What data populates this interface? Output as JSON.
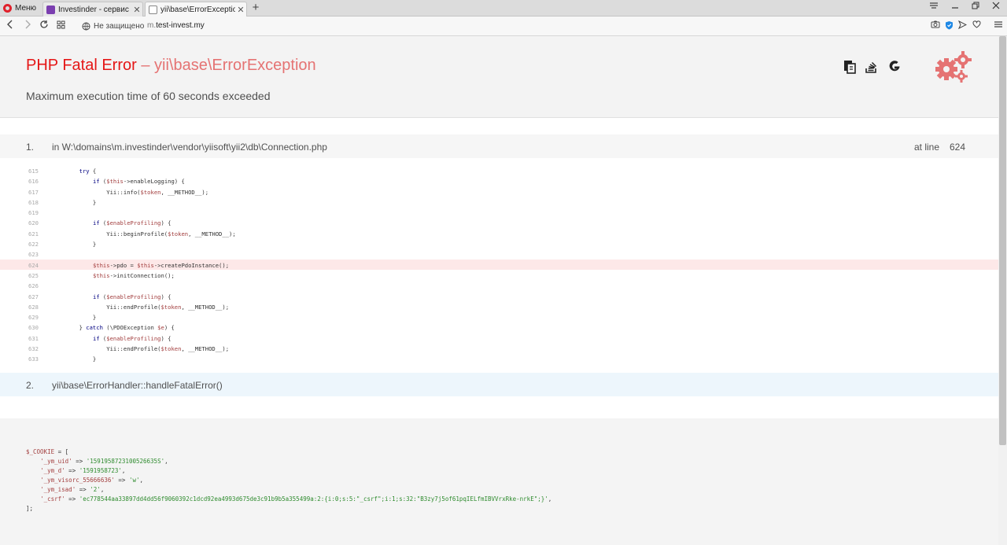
{
  "browser": {
    "menu_label": "Меню",
    "tabs": [
      {
        "title": "Investinder - сервис знако"
      },
      {
        "title": "yii\\base\\ErrorException"
      }
    ],
    "new_tab": "+",
    "security_label": "Не защищено",
    "url_subdomain": "m.",
    "url_domain": "test-invest.my"
  },
  "error": {
    "type": "PHP Fatal Error",
    "separator": " – ",
    "class": "yii\\base\\ErrorException",
    "message": "Maximum execution time of 60 seconds exceeded"
  },
  "trace": [
    {
      "number": "1.",
      "file": "in W:\\domains\\m.investinder\\vendor\\yiisoft\\yii2\\db\\Connection.php",
      "at_label": "at line",
      "line": "624"
    },
    {
      "number": "2.",
      "file": "yii\\base\\ErrorHandler::handleFatalError()"
    }
  ],
  "code_lines": [
    {
      "n": "615",
      "code": "        try {"
    },
    {
      "n": "616",
      "code": "            if ($this->enableLogging) {"
    },
    {
      "n": "617",
      "code": "                Yii::info($token, __METHOD__);"
    },
    {
      "n": "618",
      "code": "            }"
    },
    {
      "n": "619",
      "code": ""
    },
    {
      "n": "620",
      "code": "            if ($enableProfiling) {"
    },
    {
      "n": "621",
      "code": "                Yii::beginProfile($token, __METHOD__);"
    },
    {
      "n": "622",
      "code": "            }"
    },
    {
      "n": "623",
      "code": ""
    },
    {
      "n": "624",
      "code": "            $this->pdo = $this->createPdoInstance();",
      "highlight": true
    },
    {
      "n": "625",
      "code": "            $this->initConnection();"
    },
    {
      "n": "626",
      "code": ""
    },
    {
      "n": "627",
      "code": "            if ($enableProfiling) {"
    },
    {
      "n": "628",
      "code": "                Yii::endProfile($token, __METHOD__);"
    },
    {
      "n": "629",
      "code": "            }"
    },
    {
      "n": "630",
      "code": "        } catch (\\PDOException $e) {"
    },
    {
      "n": "631",
      "code": "            if ($enableProfiling) {"
    },
    {
      "n": "632",
      "code": "                Yii::endProfile($token, __METHOD__);"
    },
    {
      "n": "633",
      "code": "            }"
    }
  ],
  "cookie": {
    "var": "$_COOKIE",
    "open": " = [",
    "close": "];",
    "entries": [
      {
        "key": "'_ym_uid'",
        "value": "'1591958723100526635S'"
      },
      {
        "key": "'_ym_d'",
        "value": "'1591958723'"
      },
      {
        "key": "'_ym_visorc_55666636'",
        "value": "'w'"
      },
      {
        "key": "'_ym_isad'",
        "value": "'2'"
      },
      {
        "key": "'_csrf'",
        "value": "'ec778544aa33897dd4dd56f9060392c1dcd92ea4993d675de3c91b9b5a355499a:2:{i:0;s:5:\"_csrf\";i:1;s:32:\"B3zy7j5of61pqIELfmIBVVrxRke-nrkE\";}'"
      }
    ]
  },
  "colors": {
    "error_red": "#e51717",
    "class_red": "#e57373",
    "highlight_bg": "#fde8e8",
    "trace2_bg": "#edf6fc"
  },
  "icons": [
    "opera-logo-icon",
    "copy-icon",
    "stackoverflow-icon",
    "google-icon",
    "gears-icon"
  ]
}
